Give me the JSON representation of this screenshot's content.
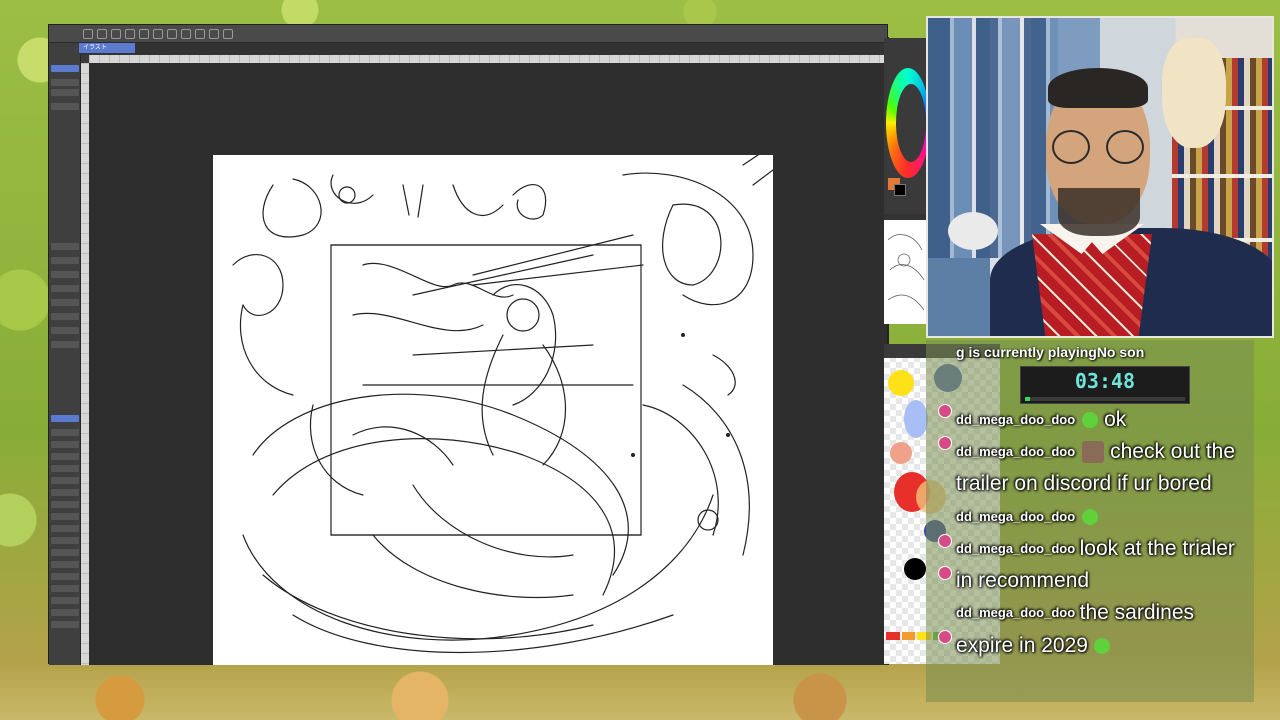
{
  "stream": {
    "now_playing": "g is currently playingNo son",
    "timer": "03:48",
    "timer_progress_fraction": 0.03
  },
  "clip_studio": {
    "tab_label": "イラスト"
  },
  "chat": {
    "messages": [
      {
        "user": "dd_mega_doo_doo",
        "emote": "green-blob",
        "text": "ok"
      },
      {
        "user": "dd_mega_doo_doo",
        "emote": "face",
        "text": "check out the trailer on discord if ur bored"
      },
      {
        "user": "dd_mega_doo_doo",
        "emote": "green-blob",
        "text": ""
      },
      {
        "user": "dd_mega_doo_doo",
        "emote": "",
        "text": "look at the trialer in recommend"
      },
      {
        "user": "dd_mega_doo_doo",
        "emote": "",
        "text": "the sardines expire in 2029",
        "trailing_emote": "green-blob"
      }
    ]
  },
  "palette_colors": [
    "#ffe11a",
    "#d9dbe8",
    "#a8bef5",
    "#f0a18a",
    "#e8302a",
    "#f2c27a",
    "#3a4a9a",
    "#000000"
  ],
  "accent": {
    "timer_color": "#6fe3d8",
    "progress_color": "#38d95a",
    "tab_color": "#5b7bd0"
  }
}
